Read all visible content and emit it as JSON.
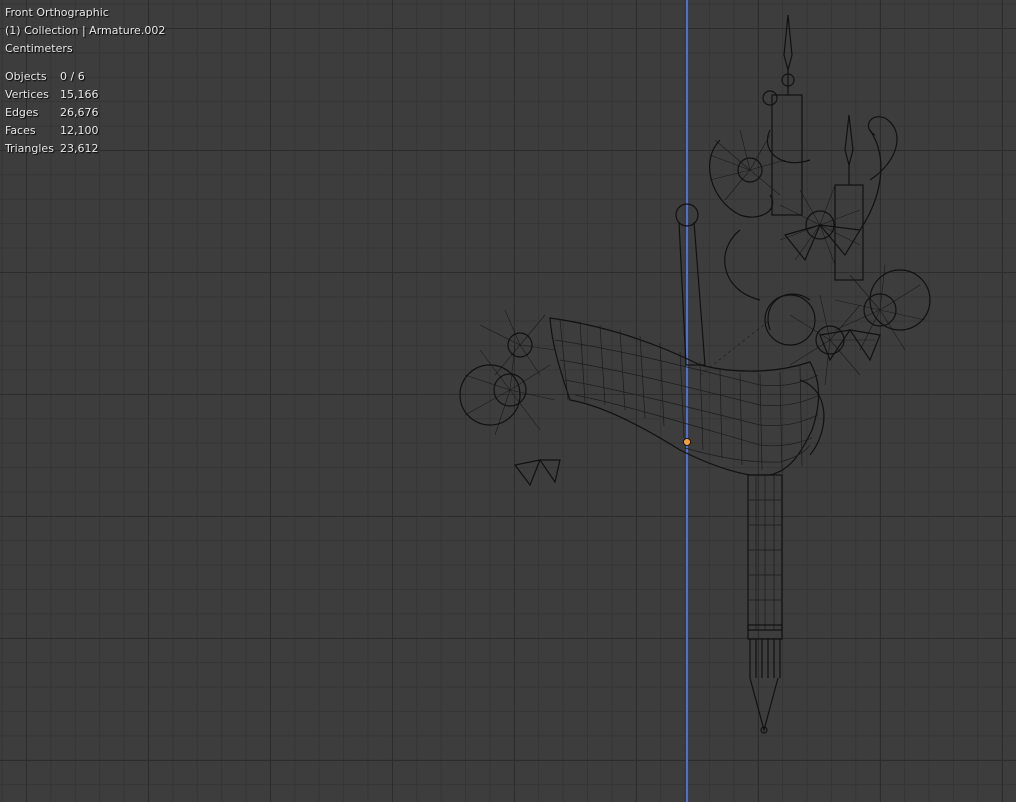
{
  "viewport": {
    "view_name": "Front Orthographic",
    "context": "(1) Collection | Armature.002",
    "units": "Centimeters"
  },
  "stats": [
    {
      "label": "Objects",
      "value": "0 / 6"
    },
    {
      "label": "Vertices",
      "value": "15,166"
    },
    {
      "label": "Edges",
      "value": "26,676"
    },
    {
      "label": "Faces",
      "value": "12,100"
    },
    {
      "label": "Triangles",
      "value": "23,612"
    }
  ],
  "colors": {
    "background": "#3d3d3d",
    "grid_major": "#2c2c2c",
    "grid_minor": "#353535",
    "z_axis": "#4f6fd3",
    "wireframe": "#111111",
    "origin": "#f0a040"
  }
}
